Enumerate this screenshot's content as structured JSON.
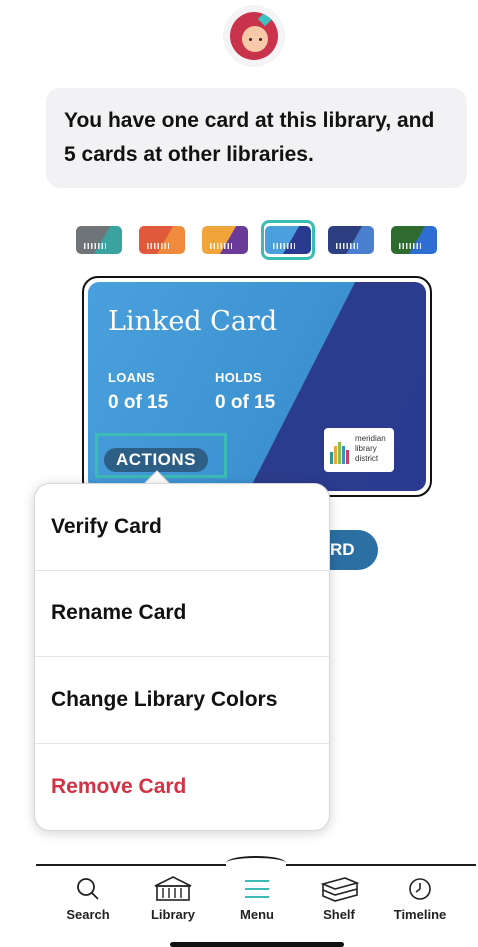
{
  "notice": {
    "text": "You have one card at this library, and 5 cards at other libraries."
  },
  "swatches": [
    {
      "name": "gray-teal",
      "colors": [
        "#6f7479",
        "#3aa3a0"
      ]
    },
    {
      "name": "orange-red",
      "colors": [
        "#e0593a",
        "#f08a3c"
      ]
    },
    {
      "name": "yellow-purple",
      "colors": [
        "#f0a43a",
        "#6a3a9a"
      ]
    },
    {
      "name": "blue-navy",
      "colors": [
        "#4aa0dc",
        "#2a3a90"
      ],
      "selected": true
    },
    {
      "name": "navy-blue",
      "colors": [
        "#2d3f80",
        "#4a7fd0"
      ]
    },
    {
      "name": "green-blue",
      "colors": [
        "#2f6a2e",
        "#2e6ed2"
      ]
    }
  ],
  "card": {
    "title": "Linked Card",
    "loans_label": "LOANS",
    "loans_value": "0 of 15",
    "holds_label": "HOLDS",
    "holds_value": "0 of 15",
    "actions_label": "ACTIONS",
    "logo_line1": "meridian",
    "logo_line2": "library",
    "logo_line3": "district"
  },
  "behind_button": {
    "label": "RD"
  },
  "menu": {
    "items": [
      {
        "label": "Verify Card"
      },
      {
        "label": "Rename Card"
      },
      {
        "label": "Change Library Colors"
      },
      {
        "label": "Remove Card"
      }
    ]
  },
  "colors": {
    "accent": "#3bbcb4",
    "danger": "#d23243",
    "card_primary": "#4aa0dc",
    "card_secondary": "#2a3a90"
  },
  "tabs": [
    {
      "label": "Search",
      "icon": "search-icon"
    },
    {
      "label": "Library",
      "icon": "library-icon"
    },
    {
      "label": "Menu",
      "icon": "menu-icon"
    },
    {
      "label": "Shelf",
      "icon": "shelf-icon"
    },
    {
      "label": "Timeline",
      "icon": "clock-icon"
    }
  ]
}
